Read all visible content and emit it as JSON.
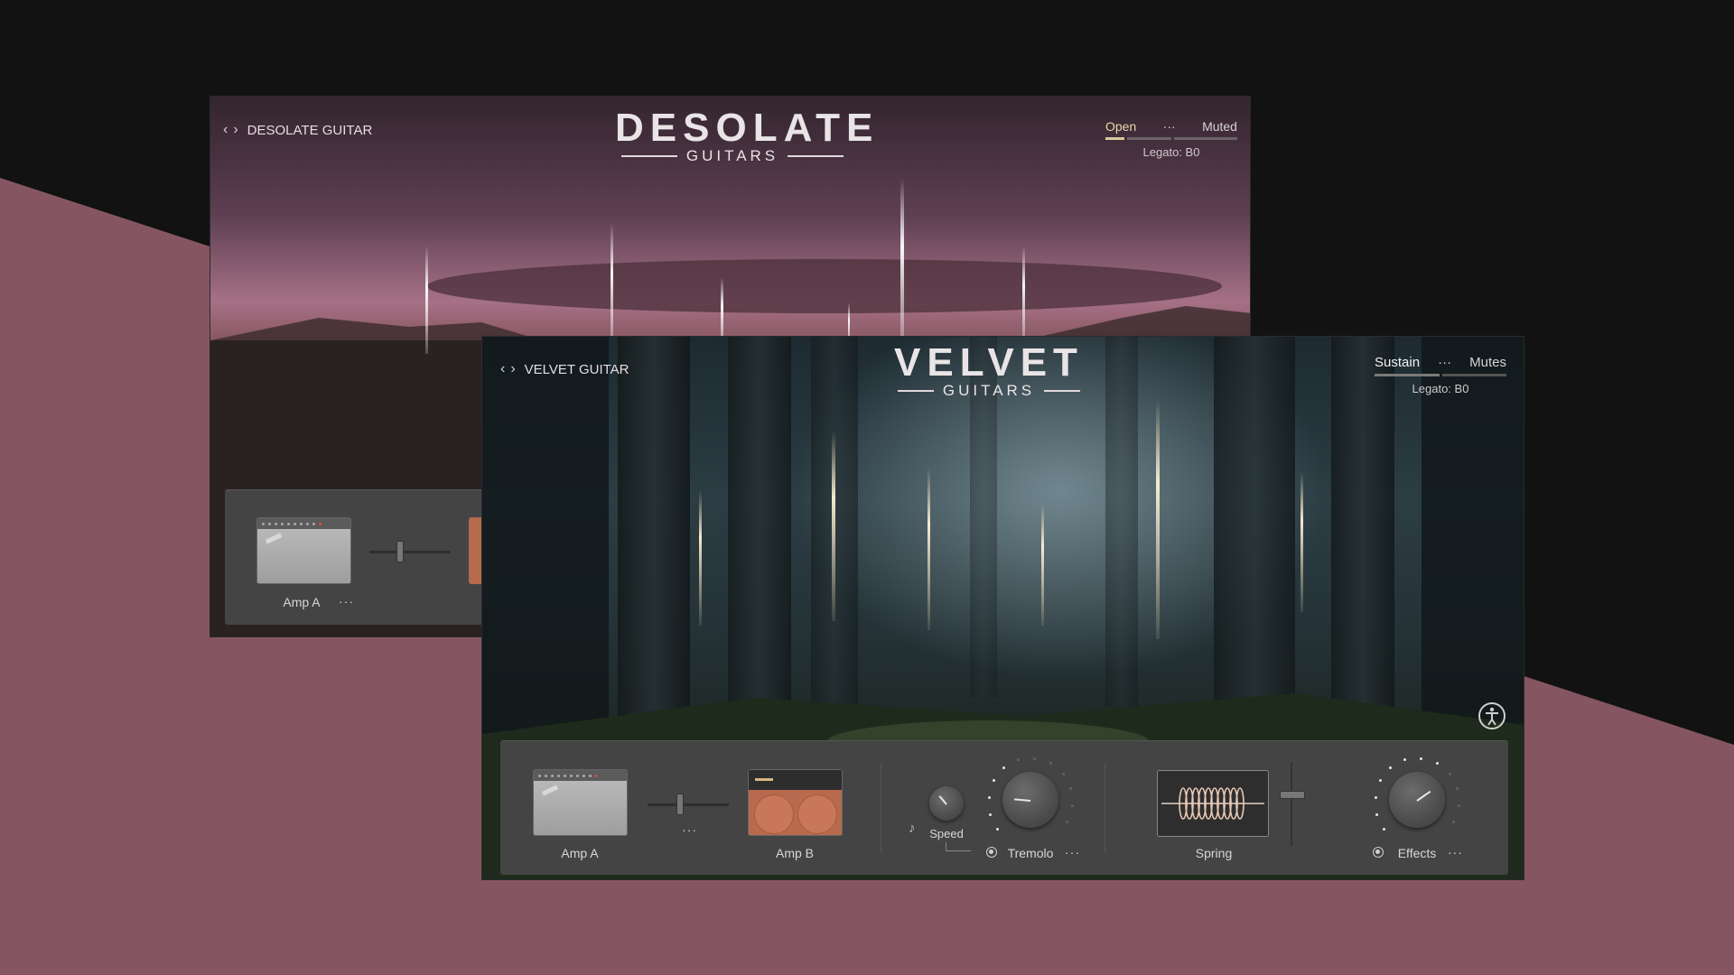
{
  "colors": {
    "background_dark": "#121212",
    "background_mauve": "#855662",
    "panel": "#444444",
    "accent_tan": "#d8c9a0",
    "amp_b": "#b76a4d"
  },
  "back_window": {
    "nav_title": "DESOLATE GUITAR",
    "logo_title": "DESOLATE",
    "logo_sub": "GUITARS",
    "articulation": {
      "left": "Open",
      "menu": "···",
      "right": "Muted",
      "legato": "Legato: B0"
    },
    "amp_label": "Amp A",
    "amp_menu": "···"
  },
  "front_window": {
    "nav_title": "VELVET GUITAR",
    "logo_title": "VELVET",
    "logo_sub": "GUITARS",
    "articulation": {
      "left": "Sustain",
      "menu": "···",
      "right": "Mutes",
      "legato": "Legato: B0"
    },
    "accessibility_icon": "accessibility-icon",
    "panel": {
      "amp_a_label": "Amp A",
      "amp_mix_menu": "···",
      "amp_b_label": "Amp B",
      "speed_label": "Speed",
      "tremolo_label": "Tremolo",
      "tremolo_menu": "···",
      "spring_label": "Spring",
      "effects_label": "Effects",
      "effects_menu": "···"
    }
  }
}
